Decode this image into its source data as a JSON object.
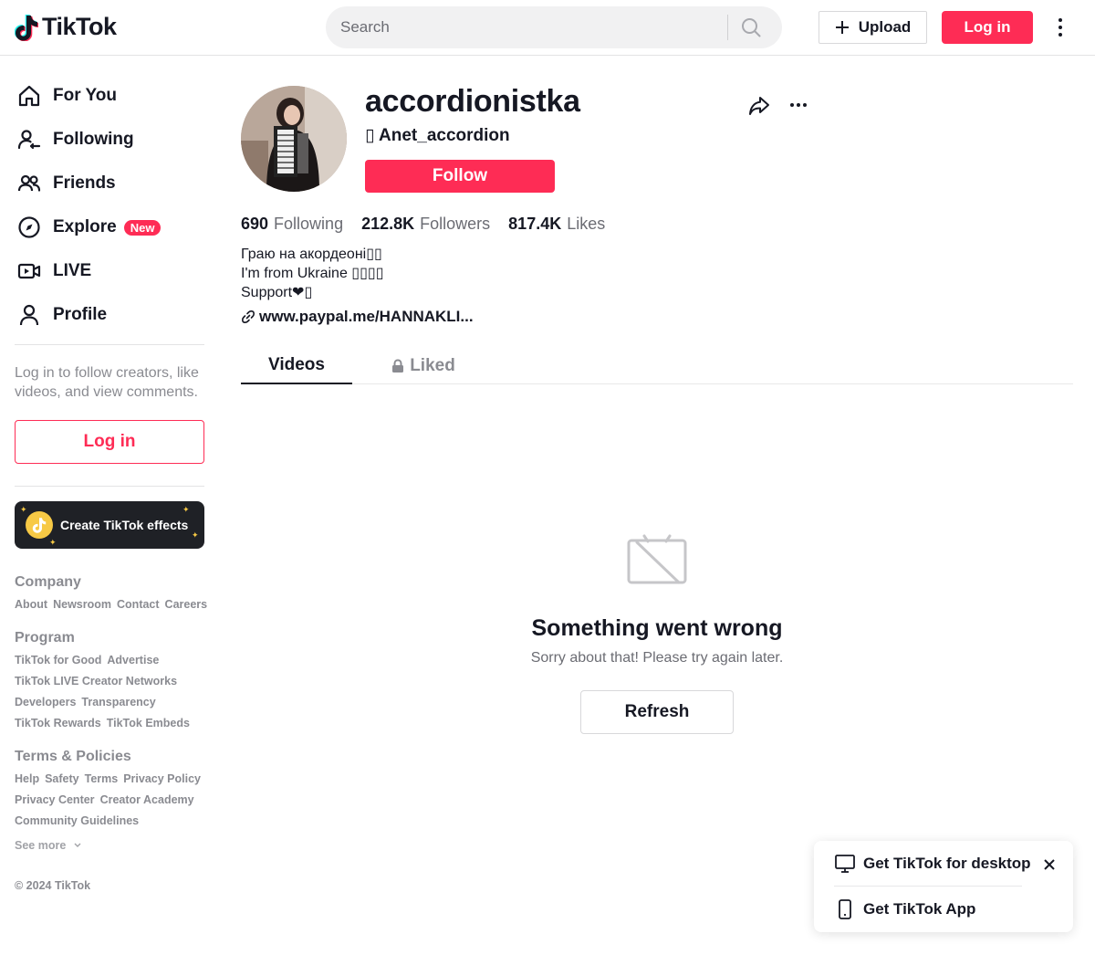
{
  "brand": {
    "name": "TikTok",
    "accent": "#fe2c55"
  },
  "header": {
    "search_placeholder": "Search",
    "upload_label": "Upload",
    "login_label": "Log in"
  },
  "sidebar": {
    "nav": [
      {
        "label": "For You",
        "icon": "home-icon"
      },
      {
        "label": "Following",
        "icon": "following-icon"
      },
      {
        "label": "Friends",
        "icon": "friends-icon"
      },
      {
        "label": "Explore",
        "icon": "compass-icon",
        "badge": "New"
      },
      {
        "label": "LIVE",
        "icon": "live-icon"
      },
      {
        "label": "Profile",
        "icon": "profile-icon"
      }
    ],
    "login_hint": "Log in to follow creators, like videos, and view comments.",
    "login_button": "Log in",
    "effects_label": "Create TikTok effects",
    "footer": {
      "company_title": "Company",
      "company_links": [
        "About",
        "Newsroom",
        "Contact",
        "Careers"
      ],
      "program_title": "Program",
      "program_links": [
        "TikTok for Good",
        "Advertise",
        "TikTok LIVE Creator Networks",
        "Developers",
        "Transparency",
        "TikTok Rewards",
        "TikTok Embeds"
      ],
      "terms_title": "Terms & Policies",
      "terms_links": [
        "Help",
        "Safety",
        "Terms",
        "Privacy Policy",
        "Privacy Center",
        "Creator Academy",
        "Community Guidelines"
      ],
      "see_more": "See more",
      "copyright": "© 2024 TikTok"
    }
  },
  "profile": {
    "username": "accordionistka",
    "nickname": "▯ Anet_accordion",
    "follow_label": "Follow",
    "stats": {
      "following_count": "690",
      "following_label": "Following",
      "followers_count": "212.8K",
      "followers_label": "Followers",
      "likes_count": "817.4K",
      "likes_label": "Likes"
    },
    "bio_lines": [
      "Граю на акордеоні▯▯",
      "I'm from Ukraine ▯▯▯▯",
      "Support❤▯"
    ],
    "link": "www.paypal.me/HANNAKLI..."
  },
  "tabs": {
    "videos": "Videos",
    "liked": "Liked"
  },
  "error": {
    "title": "Something went wrong",
    "subtitle": "Sorry about that! Please try again later.",
    "refresh_label": "Refresh"
  },
  "app_card": {
    "desktop_label": "Get TikTok for desktop",
    "app_label": "Get TikTok App"
  }
}
